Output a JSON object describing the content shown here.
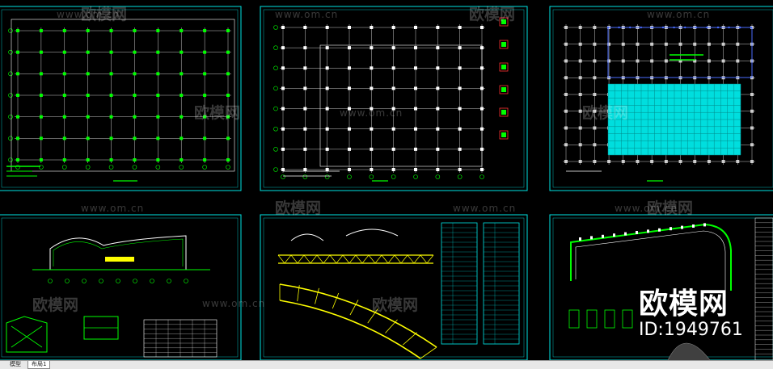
{
  "watermark": {
    "url_text": "www.om.cn",
    "brand_text": "欧模网"
  },
  "overlay": {
    "brand": "欧模网",
    "id_text": "ID:1949761"
  },
  "tabs": [
    {
      "label": "模型",
      "active": false
    },
    {
      "label": "布局1",
      "active": true
    }
  ],
  "colors": {
    "sheet_border": "#00e5e5",
    "grid_line": "#ffffff",
    "column_mark": "#00ff00",
    "axis_bubble": "#00ff00",
    "roof_fill": "#00dede",
    "truss": "#ffff00",
    "background": "#000000"
  }
}
